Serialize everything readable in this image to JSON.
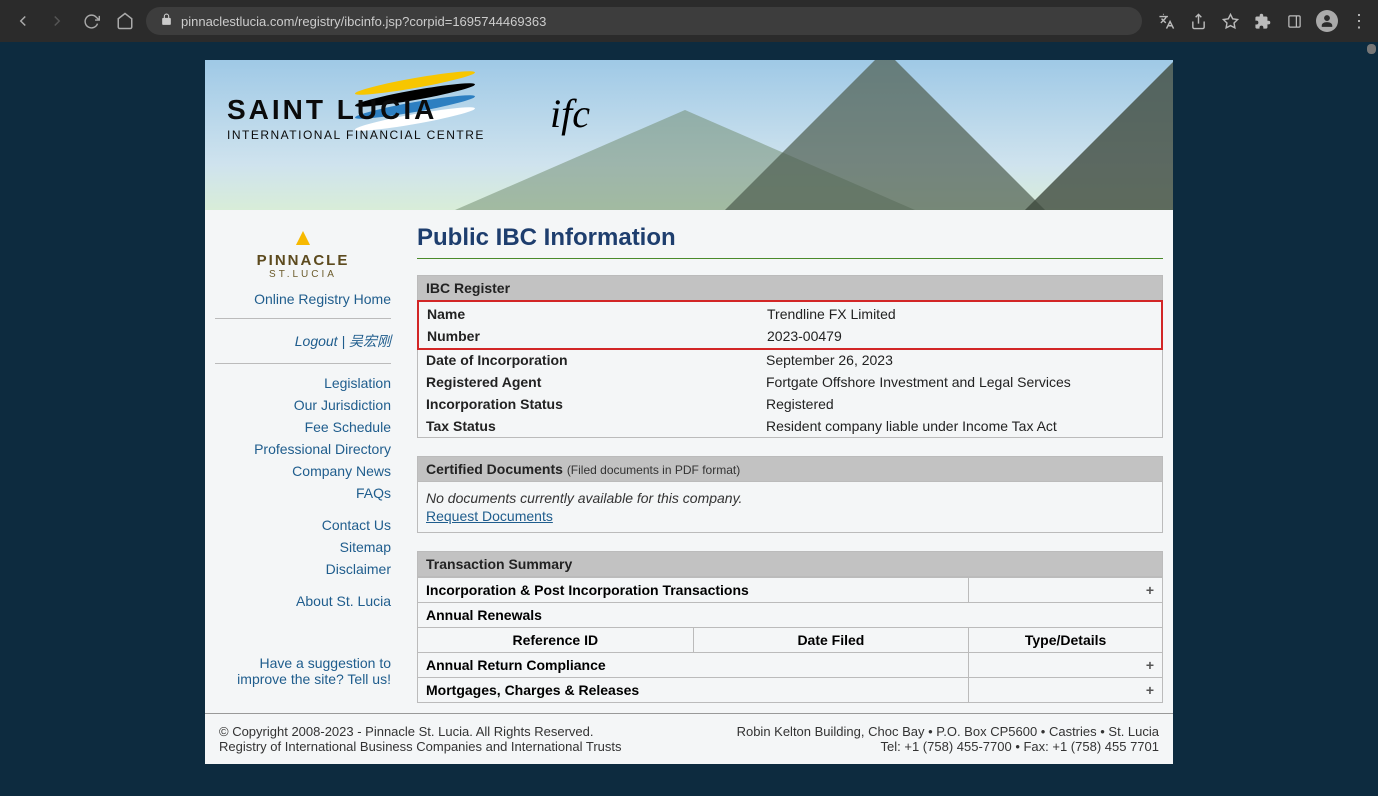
{
  "browser": {
    "url": "pinnaclestlucia.com/registry/ibcinfo.jsp?corpid=1695744469363"
  },
  "banner": {
    "title": "SAINT LUCIA",
    "subtitle": "INTERNATIONAL FINANCIAL CENTRE",
    "ifc": "ifc"
  },
  "sidebar": {
    "logo_main": "PINNACLE",
    "logo_sub": "ST.LUCIA",
    "home": "Online Registry Home",
    "logout": "Logout",
    "username": "吴宏刚",
    "links": {
      "legislation": "Legislation",
      "jurisdiction": "Our Jurisdiction",
      "fee": "Fee Schedule",
      "directory": "Professional Directory",
      "news": "Company News",
      "faqs": "FAQs",
      "contact": "Contact Us",
      "sitemap": "Sitemap",
      "disclaimer": "Disclaimer",
      "about": "About St. Lucia",
      "suggest": "Have a suggestion to improve the site? Tell us!"
    }
  },
  "page_title": "Public IBC Information",
  "ibc": {
    "section": "IBC Register",
    "name_label": "Name",
    "name_value": "Trendline FX Limited",
    "number_label": "Number",
    "number_value": "2023-00479",
    "doi_label": "Date of Incorporation",
    "doi_value": "September 26, 2023",
    "agent_label": "Registered Agent",
    "agent_value": "Fortgate Offshore Investment and Legal Services",
    "status_label": "Incorporation Status",
    "status_value": "Registered",
    "tax_label": "Tax Status",
    "tax_value": "Resident company liable under Income Tax Act"
  },
  "docs": {
    "head": "Certified Documents",
    "head_sub": "(Filed documents in PDF format)",
    "no_docs": "No documents currently available for this company.",
    "request": "Request Documents"
  },
  "trans": {
    "head": "Transaction Summary",
    "incorp": "Incorporation & Post Incorporation Transactions",
    "renewals": "Annual Renewals",
    "col_ref": "Reference ID",
    "col_date": "Date Filed",
    "col_type": "Type/Details",
    "compliance": "Annual Return Compliance",
    "mortgages": "Mortgages, Charges & Releases",
    "plus": "+"
  },
  "footer": {
    "copy1": "© Copyright 2008-2023 - Pinnacle St. Lucia. All Rights Reserved.",
    "copy2": "Registry of International Business Companies and International Trusts",
    "addr": "Robin Kelton Building, Choc Bay • P.O. Box CP5600 • Castries • St. Lucia",
    "tel": "Tel: +1 (758) 455-7700 • Fax: +1 (758) 455 7701"
  }
}
